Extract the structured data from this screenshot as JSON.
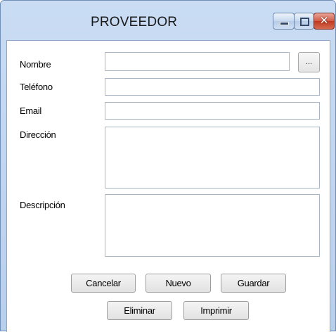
{
  "window": {
    "title": "PROVEEDOR",
    "minimize_icon": "minimize-icon",
    "maximize_icon": "maximize-icon",
    "close_icon": "close-icon",
    "close_glyph": "✕"
  },
  "form": {
    "nombre_label": "Nombre",
    "nombre_value": "",
    "browse_label": "...",
    "telefono_label": "Teléfono",
    "telefono_value": "",
    "email_label": "Email",
    "email_value": "",
    "direccion_label": "Dirección",
    "direccion_value": "",
    "descripcion_label": "Descripción",
    "descripcion_value": ""
  },
  "buttons": {
    "cancelar": "Cancelar",
    "nuevo": "Nuevo",
    "guardar": "Guardar",
    "eliminar": "Eliminar",
    "imprimir": "Imprimir"
  }
}
